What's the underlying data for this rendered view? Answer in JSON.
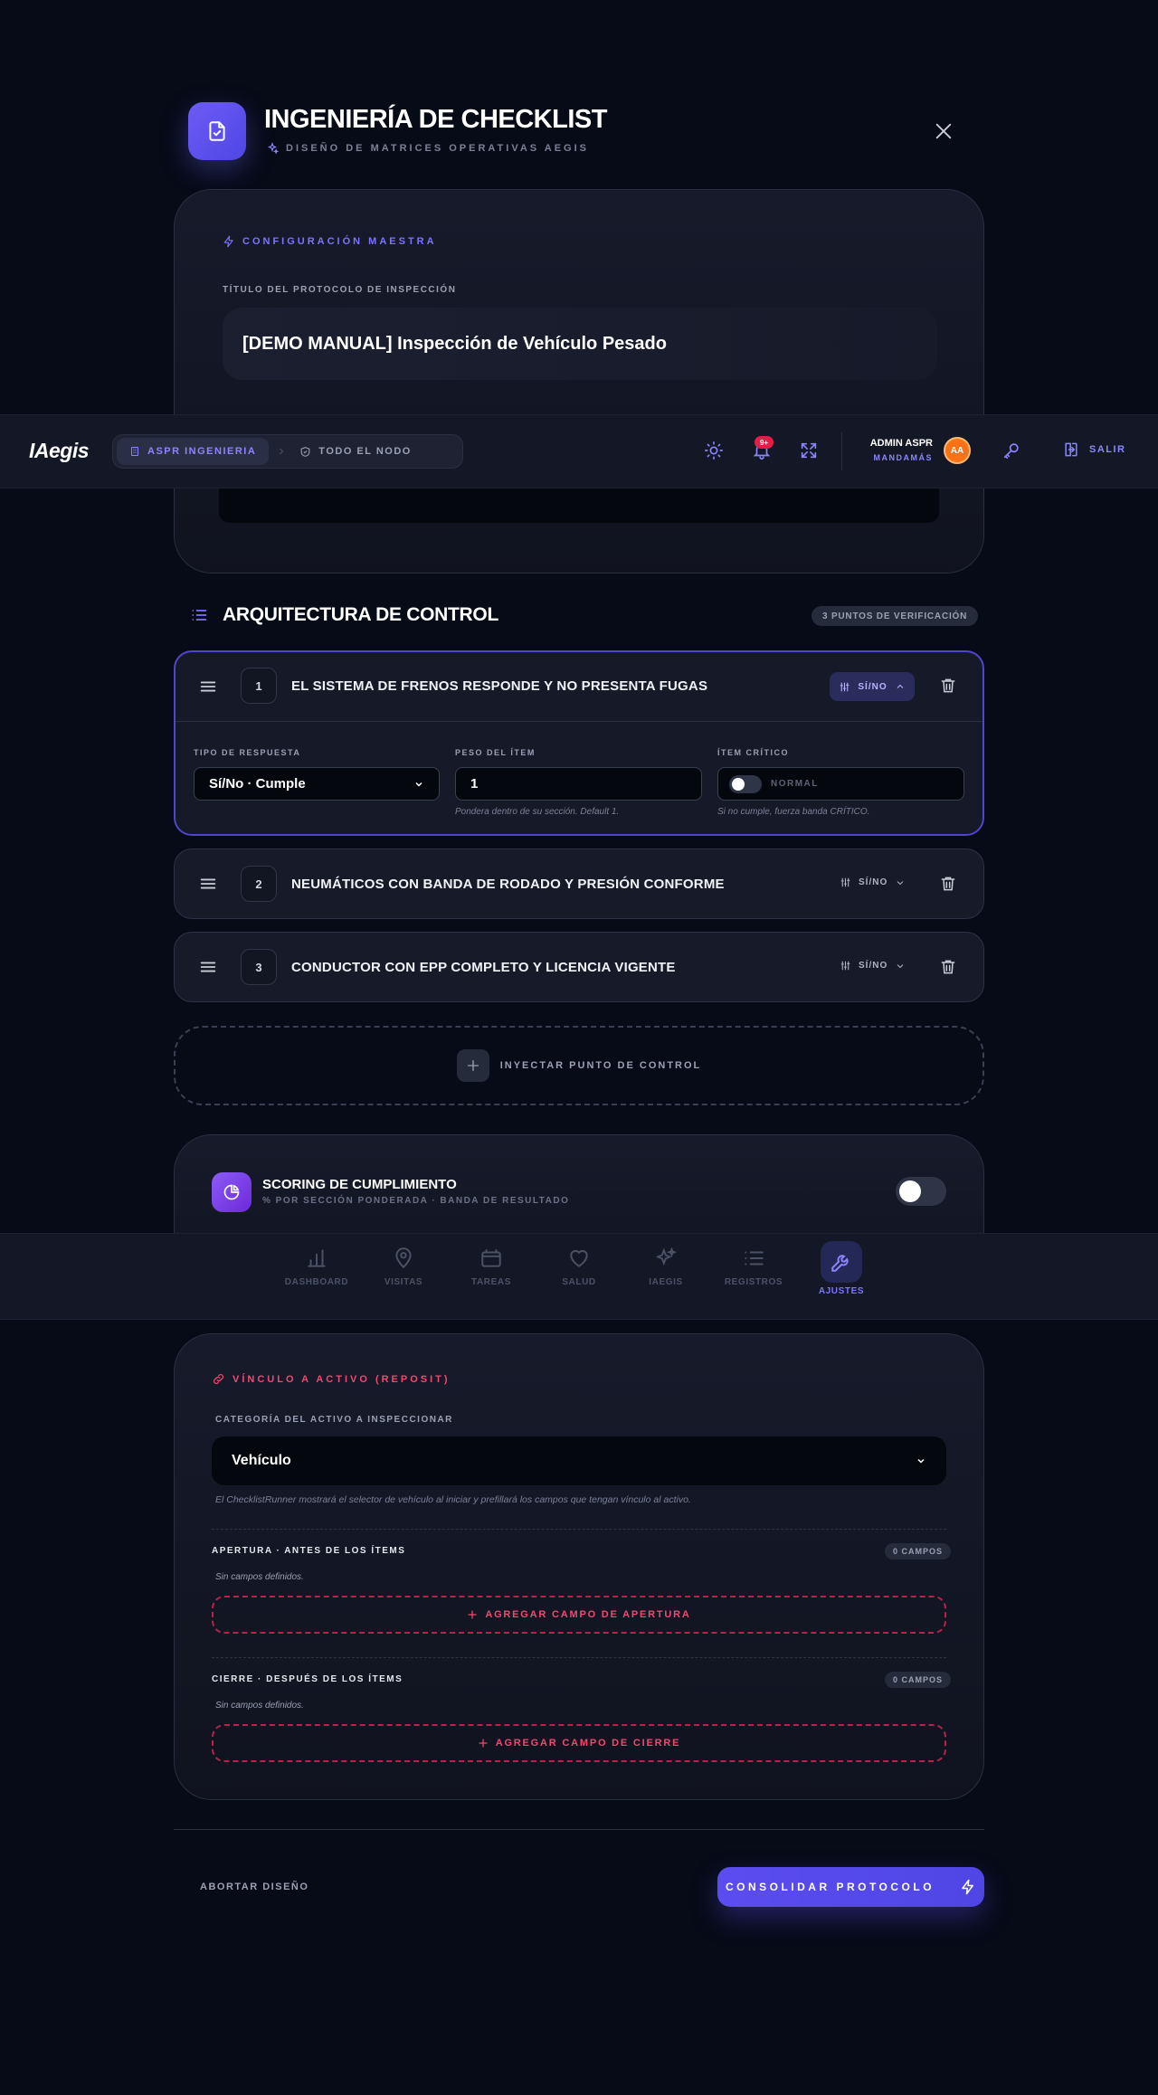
{
  "modal": {
    "title": "INGENIERÍA DE CHECKLIST",
    "subtitle": "DISEÑO DE MATRICES OPERATIVAS AEGIS"
  },
  "config": {
    "eyebrow": "CONFIGURACIÓN MAESTRA",
    "title_label": "TÍTULO DEL PROTOCOLO DE INSPECCIÓN",
    "title_value": "[DEMO MANUAL] Inspección de Vehículo Pesado"
  },
  "topbar": {
    "brand": "IAegis",
    "crumb_org": "ASPR INGENIERIA",
    "crumb_node": "TODO EL NODO",
    "notif_badge": "9+",
    "user_name": "ADMIN ASPR",
    "user_role": "MANDAMÁS",
    "avatar": "AA",
    "logout": "SALIR"
  },
  "architecture": {
    "title": "ARQUITECTURA DE CONTROL",
    "badge": "3 PUNTOS DE VERIFICACIÓN",
    "items": [
      {
        "num": "1",
        "title": "EL SISTEMA DE FRENOS RESPONDE Y NO PRESENTA FUGAS",
        "type": "SÍ/NO"
      },
      {
        "num": "2",
        "title": "NEUMÁTICOS CON BANDA DE RODADO Y PRESIÓN CONFORME",
        "type": "SÍ/NO"
      },
      {
        "num": "3",
        "title": "CONDUCTOR CON EPP COMPLETO Y LICENCIA VIGENTE",
        "type": "SÍ/NO"
      }
    ],
    "expanded": {
      "response_label": "TIPO DE RESPUESTA",
      "response_value": "Sí/No · Cumple",
      "weight_label": "PESO DEL ÍTEM",
      "weight_value": "1",
      "weight_hint": "Pondera dentro de su sección. Default 1.",
      "critical_label": "ÍTEM CRÍTICO",
      "critical_value": "NORMAL",
      "critical_hint": "Si no cumple, fuerza banda CRÍTICO."
    },
    "inject_label": "INYECTAR PUNTO DE CONTROL"
  },
  "scoring": {
    "title": "SCORING DE CUMPLIMIENTO",
    "subtitle": "% POR SECCIÓN PONDERADA · BANDA DE RESULTADO"
  },
  "tabs": [
    {
      "label": "DASHBOARD",
      "icon": "bar-chart-icon"
    },
    {
      "label": "VISITAS",
      "icon": "map-pin-icon"
    },
    {
      "label": "TAREAS",
      "icon": "tasks-icon"
    },
    {
      "label": "SALUD",
      "icon": "heart-icon"
    },
    {
      "label": "IAEGIS",
      "icon": "sparkles-icon"
    },
    {
      "label": "REGISTROS",
      "icon": "list-icon"
    },
    {
      "label": "AJUSTES",
      "icon": "settings-icon"
    }
  ],
  "asset": {
    "eyebrow": "VÍNCULO A ACTIVO (REPOSIT)",
    "category_label": "CATEGORÍA DEL ACTIVO A INSPECCIONAR",
    "category_value": "Vehículo",
    "category_hint": "El ChecklistRunner mostrará el selector de vehículo al iniciar y prefillará los campos que tengan vínculo al activo.",
    "opening_title": "APERTURA · ANTES DE LOS ÍTEMS",
    "opening_count": "0 CAMPOS",
    "opening_empty": "Sin campos definidos.",
    "opening_add": "AGREGAR CAMPO DE APERTURA",
    "closing_title": "CIERRE · DESPUÉS DE LOS ÍTEMS",
    "closing_count": "0 CAMPOS",
    "closing_empty": "Sin campos definidos.",
    "closing_add": "AGREGAR CAMPO DE CIERRE"
  },
  "footer": {
    "abort": "ABORTAR DISEÑO",
    "submit": "CONSOLIDAR PROTOCOLO"
  },
  "colors": {
    "accent": "#5b4cf0",
    "danger": "#f04970",
    "background": "#070a17"
  }
}
